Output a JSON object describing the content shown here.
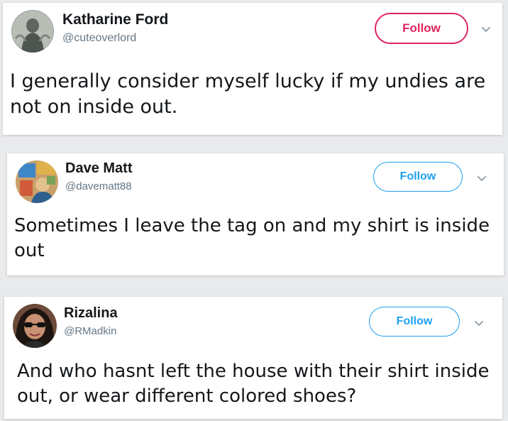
{
  "tweets": [
    {
      "name": "Katharine Ford",
      "handle": "@cuteoverlord",
      "follow_label": "Follow",
      "text": "I generally consider myself lucky if my undies are not on inside out.",
      "follow_color": "#e0245e"
    },
    {
      "name": "Dave Matt",
      "handle": "@davematt88",
      "follow_label": "Follow",
      "text": "Sometimes I leave the tag on and my shirt is inside out",
      "follow_color": "#1da1f2"
    },
    {
      "name": "Rizalina",
      "handle": "@RMadkin",
      "follow_label": "Follow",
      "text": "And who hasnt left the house with their shirt inside out, or wear different colored shoes?",
      "follow_color": "#1da1f2"
    }
  ],
  "icons": {
    "more": "chevron-down-icon"
  }
}
